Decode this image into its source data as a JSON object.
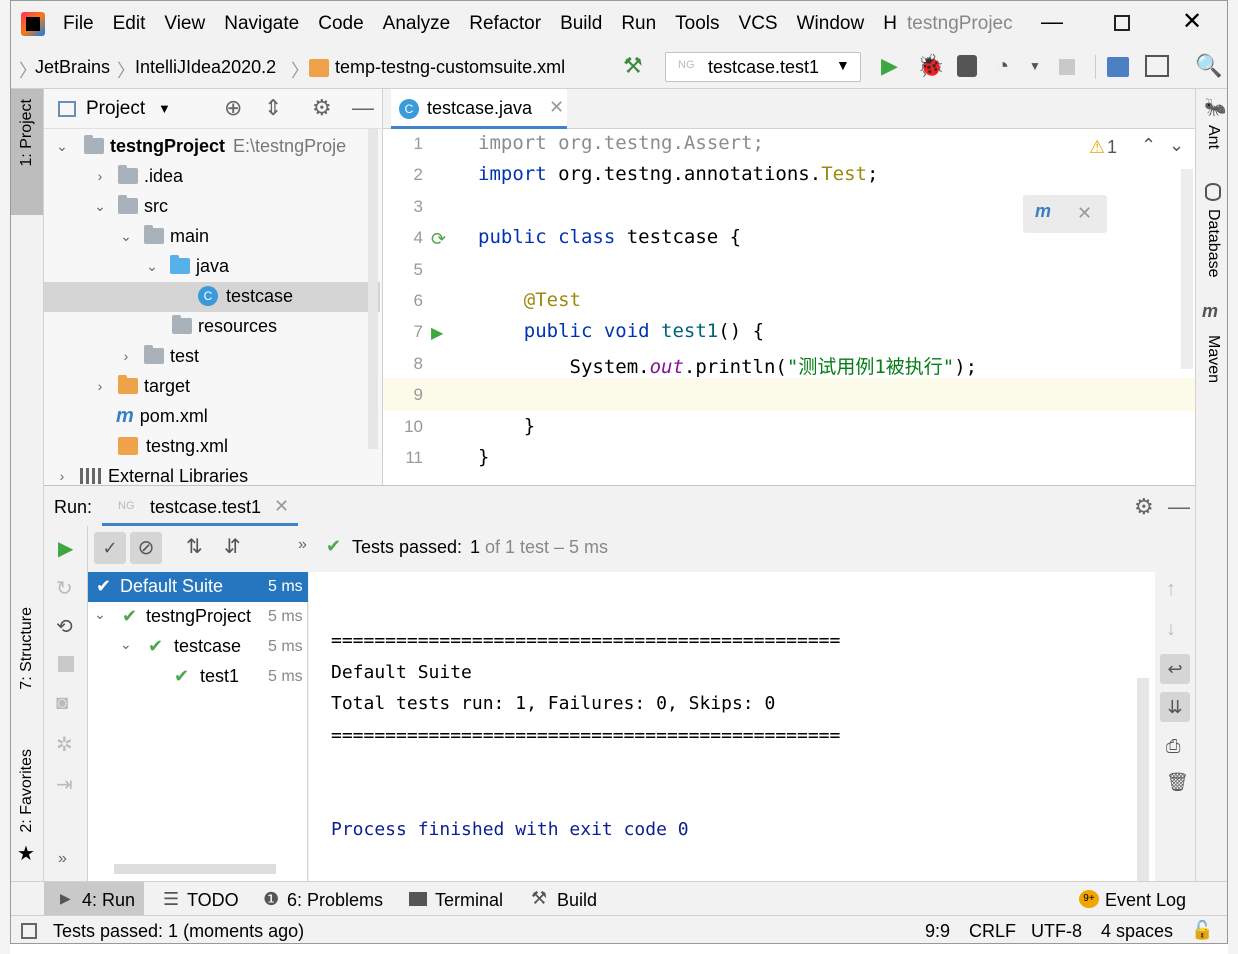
{
  "titlebar": {
    "menus": [
      "File",
      "Edit",
      "View",
      "Navigate",
      "Code",
      "Analyze",
      "Refactor",
      "Build",
      "Run",
      "Tools",
      "VCS",
      "Window",
      "H"
    ],
    "title": "testngProjec"
  },
  "navbar": {
    "crumbs": [
      "JetBrains",
      "IntelliJIdea2020.2",
      "temp-testng-customsuite.xml"
    ],
    "run_config": "testcase.test1"
  },
  "project_panel": {
    "title": "Project",
    "root_name": "testngProject",
    "root_path": "E:\\testngProje",
    "items": [
      ".idea",
      "src",
      "main",
      "java",
      "testcase",
      "resources",
      "test",
      "target",
      "pom.xml",
      "testng.xml",
      "External Libraries"
    ]
  },
  "left_tabs": {
    "project": "1: Project",
    "structure": "7: Structure",
    "favorites": "2: Favorites"
  },
  "right_tabs": {
    "ant": "Ant",
    "database": "Database",
    "maven": "Maven"
  },
  "editor": {
    "tab": "testcase.java",
    "warning_count": "1",
    "lines": [
      {
        "n": "1",
        "parts": [
          {
            "t": "import ",
            "c": "grey"
          },
          {
            "t": "org.testng.Assert;",
            "c": "grey"
          }
        ]
      },
      {
        "n": "2",
        "parts": [
          {
            "t": "import ",
            "c": "kw"
          },
          {
            "t": "org.testng.annotations.",
            "c": ""
          },
          {
            "t": "Test",
            "c": "ann"
          },
          {
            "t": ";",
            "c": ""
          }
        ]
      },
      {
        "n": "3",
        "parts": []
      },
      {
        "n": "4",
        "parts": [
          {
            "t": "public class ",
            "c": "kw"
          },
          {
            "t": "testcase {",
            "c": ""
          }
        ]
      },
      {
        "n": "5",
        "parts": []
      },
      {
        "n": "6",
        "parts": [
          {
            "t": "    @Test",
            "c": "ann"
          }
        ]
      },
      {
        "n": "7",
        "parts": [
          {
            "t": "    ",
            "c": ""
          },
          {
            "t": "public void ",
            "c": "kw"
          },
          {
            "t": "test1",
            "c": "kw2"
          },
          {
            "t": "() {",
            "c": ""
          }
        ]
      },
      {
        "n": "8",
        "parts": [
          {
            "t": "        System.",
            "c": ""
          },
          {
            "t": "out",
            "c": "fld"
          },
          {
            "t": ".println(",
            "c": ""
          },
          {
            "t": "\"测试用例1被执行\"",
            "c": "str"
          },
          {
            "t": ");",
            "c": ""
          }
        ]
      },
      {
        "n": "9",
        "parts": []
      },
      {
        "n": "10",
        "parts": [
          {
            "t": "    }",
            "c": ""
          }
        ]
      },
      {
        "n": "11",
        "parts": [
          {
            "t": "}",
            "c": ""
          }
        ]
      }
    ]
  },
  "run_panel": {
    "label": "Run:",
    "tab": "testcase.test1",
    "status_passed": "Tests passed:",
    "status_count": "1",
    "status_rest": "of 1 test – 5 ms",
    "tree": [
      {
        "name": "Default Suite",
        "time": "5 ms"
      },
      {
        "name": "testngProject",
        "time": "5 ms"
      },
      {
        "name": "testcase",
        "time": "5 ms"
      },
      {
        "name": "test1",
        "time": "5 ms"
      }
    ],
    "console": [
      "===============================================",
      "Default Suite",
      "Total tests run: 1, Failures: 0, Skips: 0",
      "===============================================",
      "",
      "",
      "Process finished with exit code 0"
    ]
  },
  "bottom_tabs": {
    "run": "4: Run",
    "todo": "TODO",
    "problems": "6: Problems",
    "terminal": "Terminal",
    "build": "Build",
    "event_log": "Event Log",
    "event_badge": "9+"
  },
  "statusbar": {
    "message": "Tests passed: 1 (moments ago)",
    "position": "9:9",
    "line_sep": "CRLF",
    "encoding": "UTF-8",
    "indent": "4 spaces"
  }
}
